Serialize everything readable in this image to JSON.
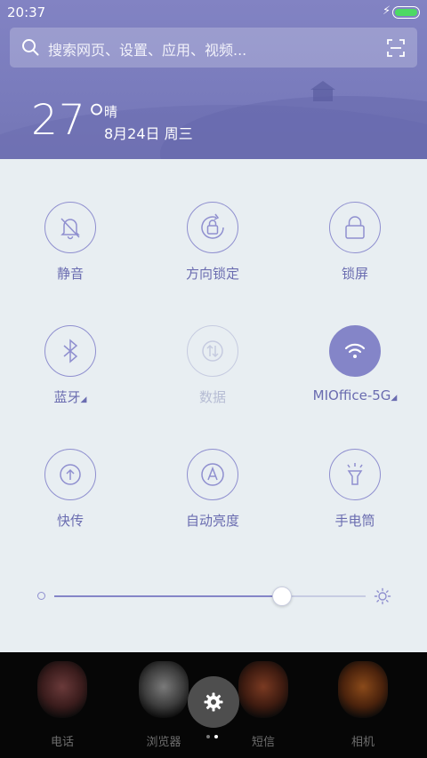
{
  "status_bar": {
    "time": "20:37",
    "charging_icon": "bolt-icon",
    "battery_level": 1.0,
    "battery_color": "#4cd964"
  },
  "search": {
    "placeholder": "搜索网页、设置、应用、视频...",
    "left_icon": "search-icon",
    "right_icon": "scan-icon"
  },
  "weather": {
    "temperature": "27°",
    "condition": "晴",
    "date": "8月24日 周三"
  },
  "toggles": [
    {
      "label": "静音",
      "icon": "bell-off-icon",
      "state": "off"
    },
    {
      "label": "方向锁定",
      "icon": "rotation-lock-icon",
      "state": "off"
    },
    {
      "label": "锁屏",
      "icon": "lock-icon",
      "state": "off"
    },
    {
      "label": "蓝牙",
      "icon": "bluetooth-icon",
      "state": "off",
      "has_menu": true
    },
    {
      "label": "数据",
      "icon": "mobile-data-icon",
      "state": "disabled"
    },
    {
      "label": "MIOffice-5G",
      "icon": "wifi-icon",
      "state": "on",
      "has_menu": true
    },
    {
      "label": "快传",
      "icon": "transfer-icon",
      "state": "off"
    },
    {
      "label": "自动亮度",
      "icon": "auto-brightness-icon",
      "state": "off"
    },
    {
      "label": "手电筒",
      "icon": "flashlight-icon",
      "state": "off"
    }
  ],
  "brightness": {
    "level": 0.73,
    "min_icon": "brightness-low-icon",
    "max_icon": "brightness-high-icon"
  },
  "dock": {
    "apps": [
      {
        "label": "电话",
        "icon": "phone-app-icon"
      },
      {
        "label": "浏览器",
        "icon": "browser-app-icon"
      },
      {
        "label": "短信",
        "icon": "messages-app-icon"
      },
      {
        "label": "相机",
        "icon": "camera-app-icon"
      }
    ],
    "settings_button_icon": "gear-icon",
    "page_count": 2,
    "current_page": 2
  },
  "colors": {
    "accent": "#8485c8",
    "header": "#7a7cbd",
    "panel": "#e8eef2"
  }
}
